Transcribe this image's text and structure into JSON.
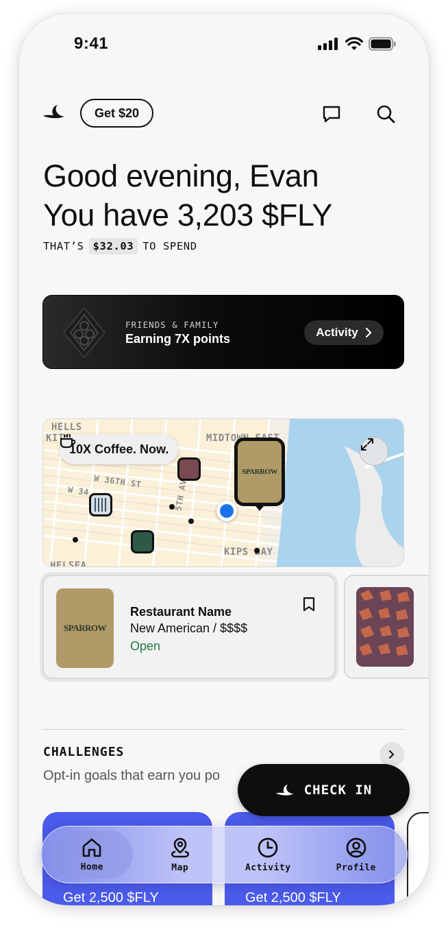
{
  "status_bar": {
    "time": "9:41"
  },
  "header": {
    "promo_button": "Get $20"
  },
  "greeting": {
    "line1": "Good evening, Evan",
    "line2": "You have 3,203 $FLY"
  },
  "spend": {
    "prefix": "THAT’S",
    "amount": "$32.03",
    "suffix": "TO SPEND"
  },
  "promo": {
    "kicker": "FRIENDS & FAMILY",
    "title": "Earning 7X points",
    "button": "Activity"
  },
  "map": {
    "labels": {
      "hells_kitchen_1": "HELLS",
      "hells_kitchen_2": "KITC",
      "midtown_east": "MIDTOWN EAST",
      "w36": "W 36TH ST",
      "w34": "W 34",
      "fifth_ave": "5TH AV",
      "kips_bay": "KIPS BAY",
      "chelsea": "HELSEA"
    },
    "offer_pill": "10X Coffee. Now.",
    "big_pin_logo": "SPARROW"
  },
  "restaurant": {
    "name": "Restaurant Name",
    "cuisine": "New American / $$$$",
    "status": "Open",
    "logo": "SPARROW"
  },
  "challenges": {
    "title": "CHALLENGES",
    "subtitle": "Opt-in goals that earn you po",
    "cards": [
      {
        "reward": "Get 2,500 $FLY"
      },
      {
        "reward": "Get 2,500 $FLY"
      }
    ]
  },
  "checkin": {
    "label": "CHECK IN"
  },
  "tabs": [
    {
      "label": "Home",
      "icon": "home-icon",
      "active": true
    },
    {
      "label": "Map",
      "icon": "map-pin-icon",
      "active": false
    },
    {
      "label": "Activity",
      "icon": "clock-icon",
      "active": false
    },
    {
      "label": "Profile",
      "icon": "profile-icon",
      "active": false
    }
  ],
  "colors": {
    "accent_blue": "#4b5bea",
    "open_green": "#1e7a44",
    "user_location": "#1a73e8",
    "sparrow_gold": "#b09a67"
  }
}
